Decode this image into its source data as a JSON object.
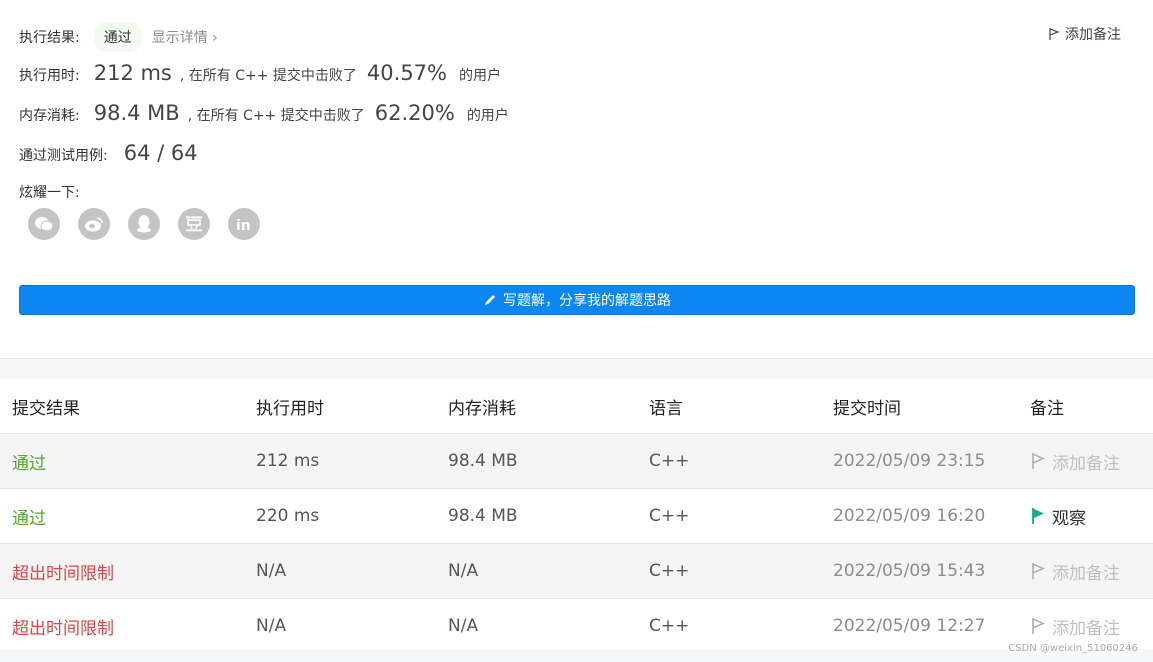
{
  "summary": {
    "result_label": "执行结果:",
    "result_value": "通过",
    "detail_link": "显示详情 ›",
    "add_note": "添加备注",
    "runtime_label": "执行用时:",
    "runtime_value": "212 ms",
    "runtime_mid": ", 在所有 C++ 提交中击败了",
    "runtime_pct": "40.57%",
    "runtime_tail": "的用户",
    "memory_label": "内存消耗:",
    "memory_value": "98.4 MB",
    "memory_mid": ", 在所有 C++ 提交中击败了",
    "memory_pct": "62.20%",
    "memory_tail": "的用户",
    "tests_label": "通过测试用例:",
    "tests_value": "64 / 64",
    "share_label": "炫耀一下:",
    "share_icons": [
      "wechat-icon",
      "weibo-icon",
      "qq-icon",
      "douban-icon",
      "linkedin-icon"
    ],
    "solution_button": "写题解，分享我的解题思路"
  },
  "table": {
    "headers": [
      "提交结果",
      "执行用时",
      "内存消耗",
      "语言",
      "提交时间",
      "备注"
    ],
    "rows": [
      {
        "result": "通过",
        "time": "212 ms",
        "memory": "98.4 MB",
        "lang": "C++",
        "submitted": "2022/05/09 23:15",
        "note": "添加备注"
      },
      {
        "result": "通过",
        "time": "220 ms",
        "memory": "98.4 MB",
        "lang": "C++",
        "submitted": "2022/05/09 16:20",
        "note": "观察"
      },
      {
        "result": "超出时间限制",
        "time": "N/A",
        "memory": "N/A",
        "lang": "C++",
        "submitted": "2022/05/09 15:43",
        "note": "添加备注"
      },
      {
        "result": "超出时间限制",
        "time": "N/A",
        "memory": "N/A",
        "lang": "C++",
        "submitted": "2022/05/09 12:27",
        "note": "添加备注"
      }
    ]
  },
  "watermark": "CSDN @weixin_51060246",
  "colors": {
    "accent": "#0c87f2",
    "pass": "#52a832",
    "fail": "#e04444",
    "flag_active": "#1fa88a"
  }
}
